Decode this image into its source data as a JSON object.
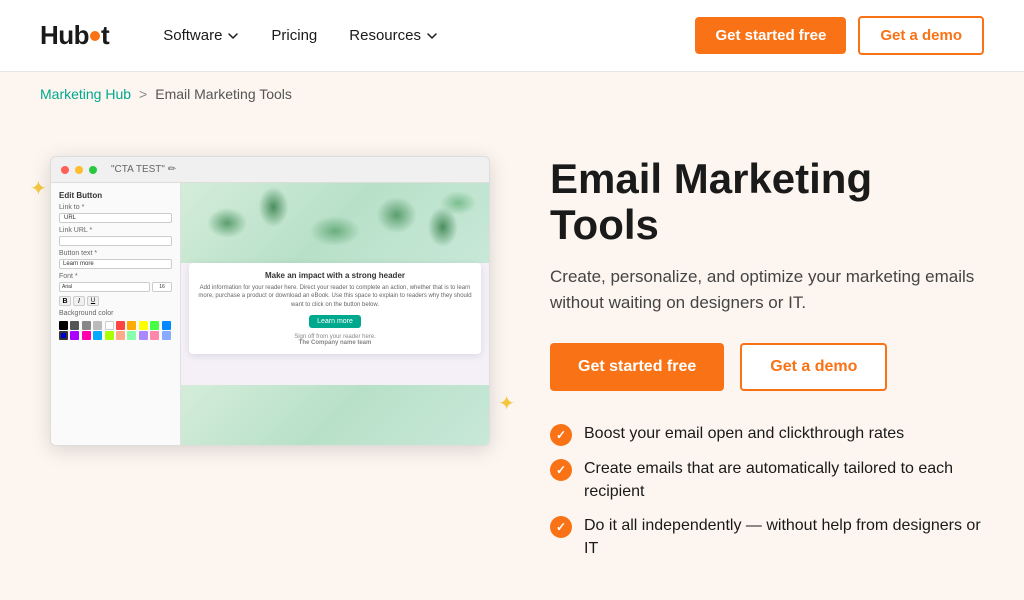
{
  "navbar": {
    "logo": {
      "text_before": "Hub",
      "text_after": "t",
      "dot_letter": "o"
    },
    "nav_items": [
      {
        "label": "Software",
        "has_chevron": true
      },
      {
        "label": "Pricing",
        "has_chevron": false
      },
      {
        "label": "Resources",
        "has_chevron": true
      }
    ],
    "cta_primary": "Get started free",
    "cta_secondary": "Get a demo"
  },
  "breadcrumb": {
    "parent": "Marketing Hub",
    "separator": ">",
    "current": "Email Marketing Tools"
  },
  "hero": {
    "title": "Email Marketing Tools",
    "description": "Create, personalize, and optimize your marketing emails without waiting on designers or IT.",
    "cta_primary": "Get started free",
    "cta_secondary": "Get a demo",
    "features": [
      "Boost your email open and clickthrough rates",
      "Create emails that are automatically tailored to each recipient",
      "Do it all independently — without help from designers or IT"
    ]
  },
  "mockup": {
    "topbar_text": "\"CTA TEST\" ✏",
    "panel_title": "Edit Button",
    "link_label": "Link to *",
    "link_type": "URL",
    "link_url_label": "Link URL *",
    "button_text_label": "Button text *",
    "button_text_val": "Learn more",
    "font_label": "Font *",
    "content_title": "Make an impact with a strong header",
    "content_body": "Add information for your reader here. Direct your reader to complete an action, whether that is to learn more, purchase a product or download an eBook. Use this space to explain to readers why they should want to click on the button below.",
    "cta_button": "Learn more",
    "sign_off": "Sign off from your reader here.",
    "company": "The Company name team"
  },
  "colors": {
    "primary_orange": "#f97316",
    "teal": "#00a88e",
    "background": "#fdf6f0"
  }
}
